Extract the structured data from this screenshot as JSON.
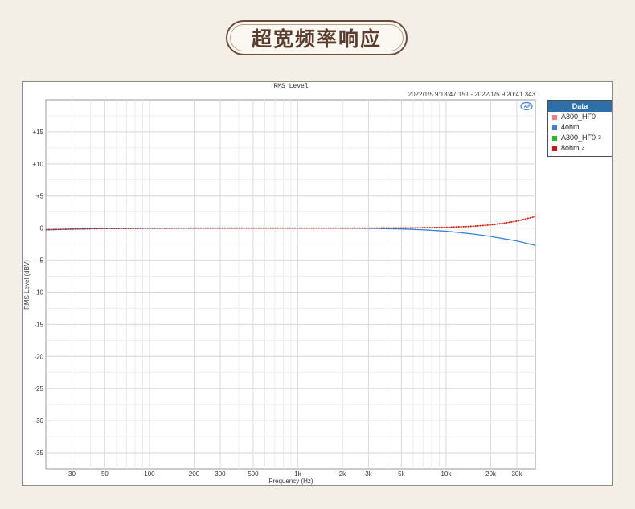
{
  "banner": {
    "title": "超宽频率响应"
  },
  "colors": {
    "background": "#f3efe6",
    "banner_border": "#6b4c3a",
    "grid": "#dedede",
    "legend_header": "#2f6fa8"
  },
  "chart_data": {
    "type": "line",
    "title": "RMS Level",
    "timestamp": "2022/1/5 9:13:47.151 -  2022/1/5 9:20:41.343",
    "xlabel": "Frequency (Hz)",
    "ylabel": "RMS Level (dBV)",
    "x_scale": "log",
    "xlim": [
      20,
      40000
    ],
    "ylim": [
      -37.5,
      20
    ],
    "x_ticks": [
      30,
      50,
      100,
      200,
      300,
      500,
      1000,
      2000,
      3000,
      5000,
      10000,
      20000,
      30000
    ],
    "x_tick_labels": [
      "30",
      "50",
      "100",
      "200",
      "300",
      "500",
      "1k",
      "2k",
      "3k",
      "5k",
      "10k",
      "20k",
      "30k"
    ],
    "y_ticks": [
      15,
      10,
      5,
      0,
      -5,
      -10,
      -15,
      -20,
      -25,
      -30,
      -35
    ],
    "y_tick_labels": [
      "+15",
      "+10",
      "+5",
      "0",
      "-5",
      "-10",
      "-15",
      "-20",
      "-25",
      "-30",
      "-35"
    ],
    "grid": true,
    "legend": {
      "title": "Data",
      "placement": "right"
    },
    "x": [
      20,
      30,
      50,
      100,
      200,
      500,
      1000,
      2000,
      3000,
      5000,
      7000,
      10000,
      15000,
      20000,
      25000,
      30000,
      40000
    ],
    "series": [
      {
        "name": "A300_HF0",
        "color": "#f08080",
        "style": "solid",
        "values": [
          -0.25,
          -0.15,
          -0.06,
          -0.02,
          -0.01,
          0,
          0,
          0,
          0,
          0.02,
          0.06,
          0.12,
          0.28,
          0.5,
          0.8,
          1.1,
          1.8
        ]
      },
      {
        "name": "4ohm",
        "color": "#3a7fd5",
        "style": "solid",
        "values": [
          -0.25,
          -0.15,
          -0.06,
          -0.02,
          -0.01,
          0,
          0,
          0,
          -0.04,
          -0.13,
          -0.26,
          -0.48,
          -0.9,
          -1.3,
          -1.7,
          -2.0,
          -2.7
        ]
      },
      {
        "name": "A300_HF0",
        "sub": "3",
        "color": "#22c022",
        "style": "dotted",
        "values": [
          -0.25,
          -0.15,
          -0.06,
          -0.02,
          -0.01,
          0,
          0,
          0,
          0,
          0.02,
          0.06,
          0.12,
          0.28,
          0.5,
          0.8,
          1.1,
          1.8
        ]
      },
      {
        "name": "8ohm",
        "sub": "3",
        "color": "#dd1111",
        "style": "dotted",
        "values": [
          -0.25,
          -0.15,
          -0.06,
          -0.02,
          -0.01,
          0,
          0,
          0,
          0,
          0.02,
          0.06,
          0.12,
          0.28,
          0.5,
          0.8,
          1.1,
          1.8
        ]
      }
    ]
  }
}
